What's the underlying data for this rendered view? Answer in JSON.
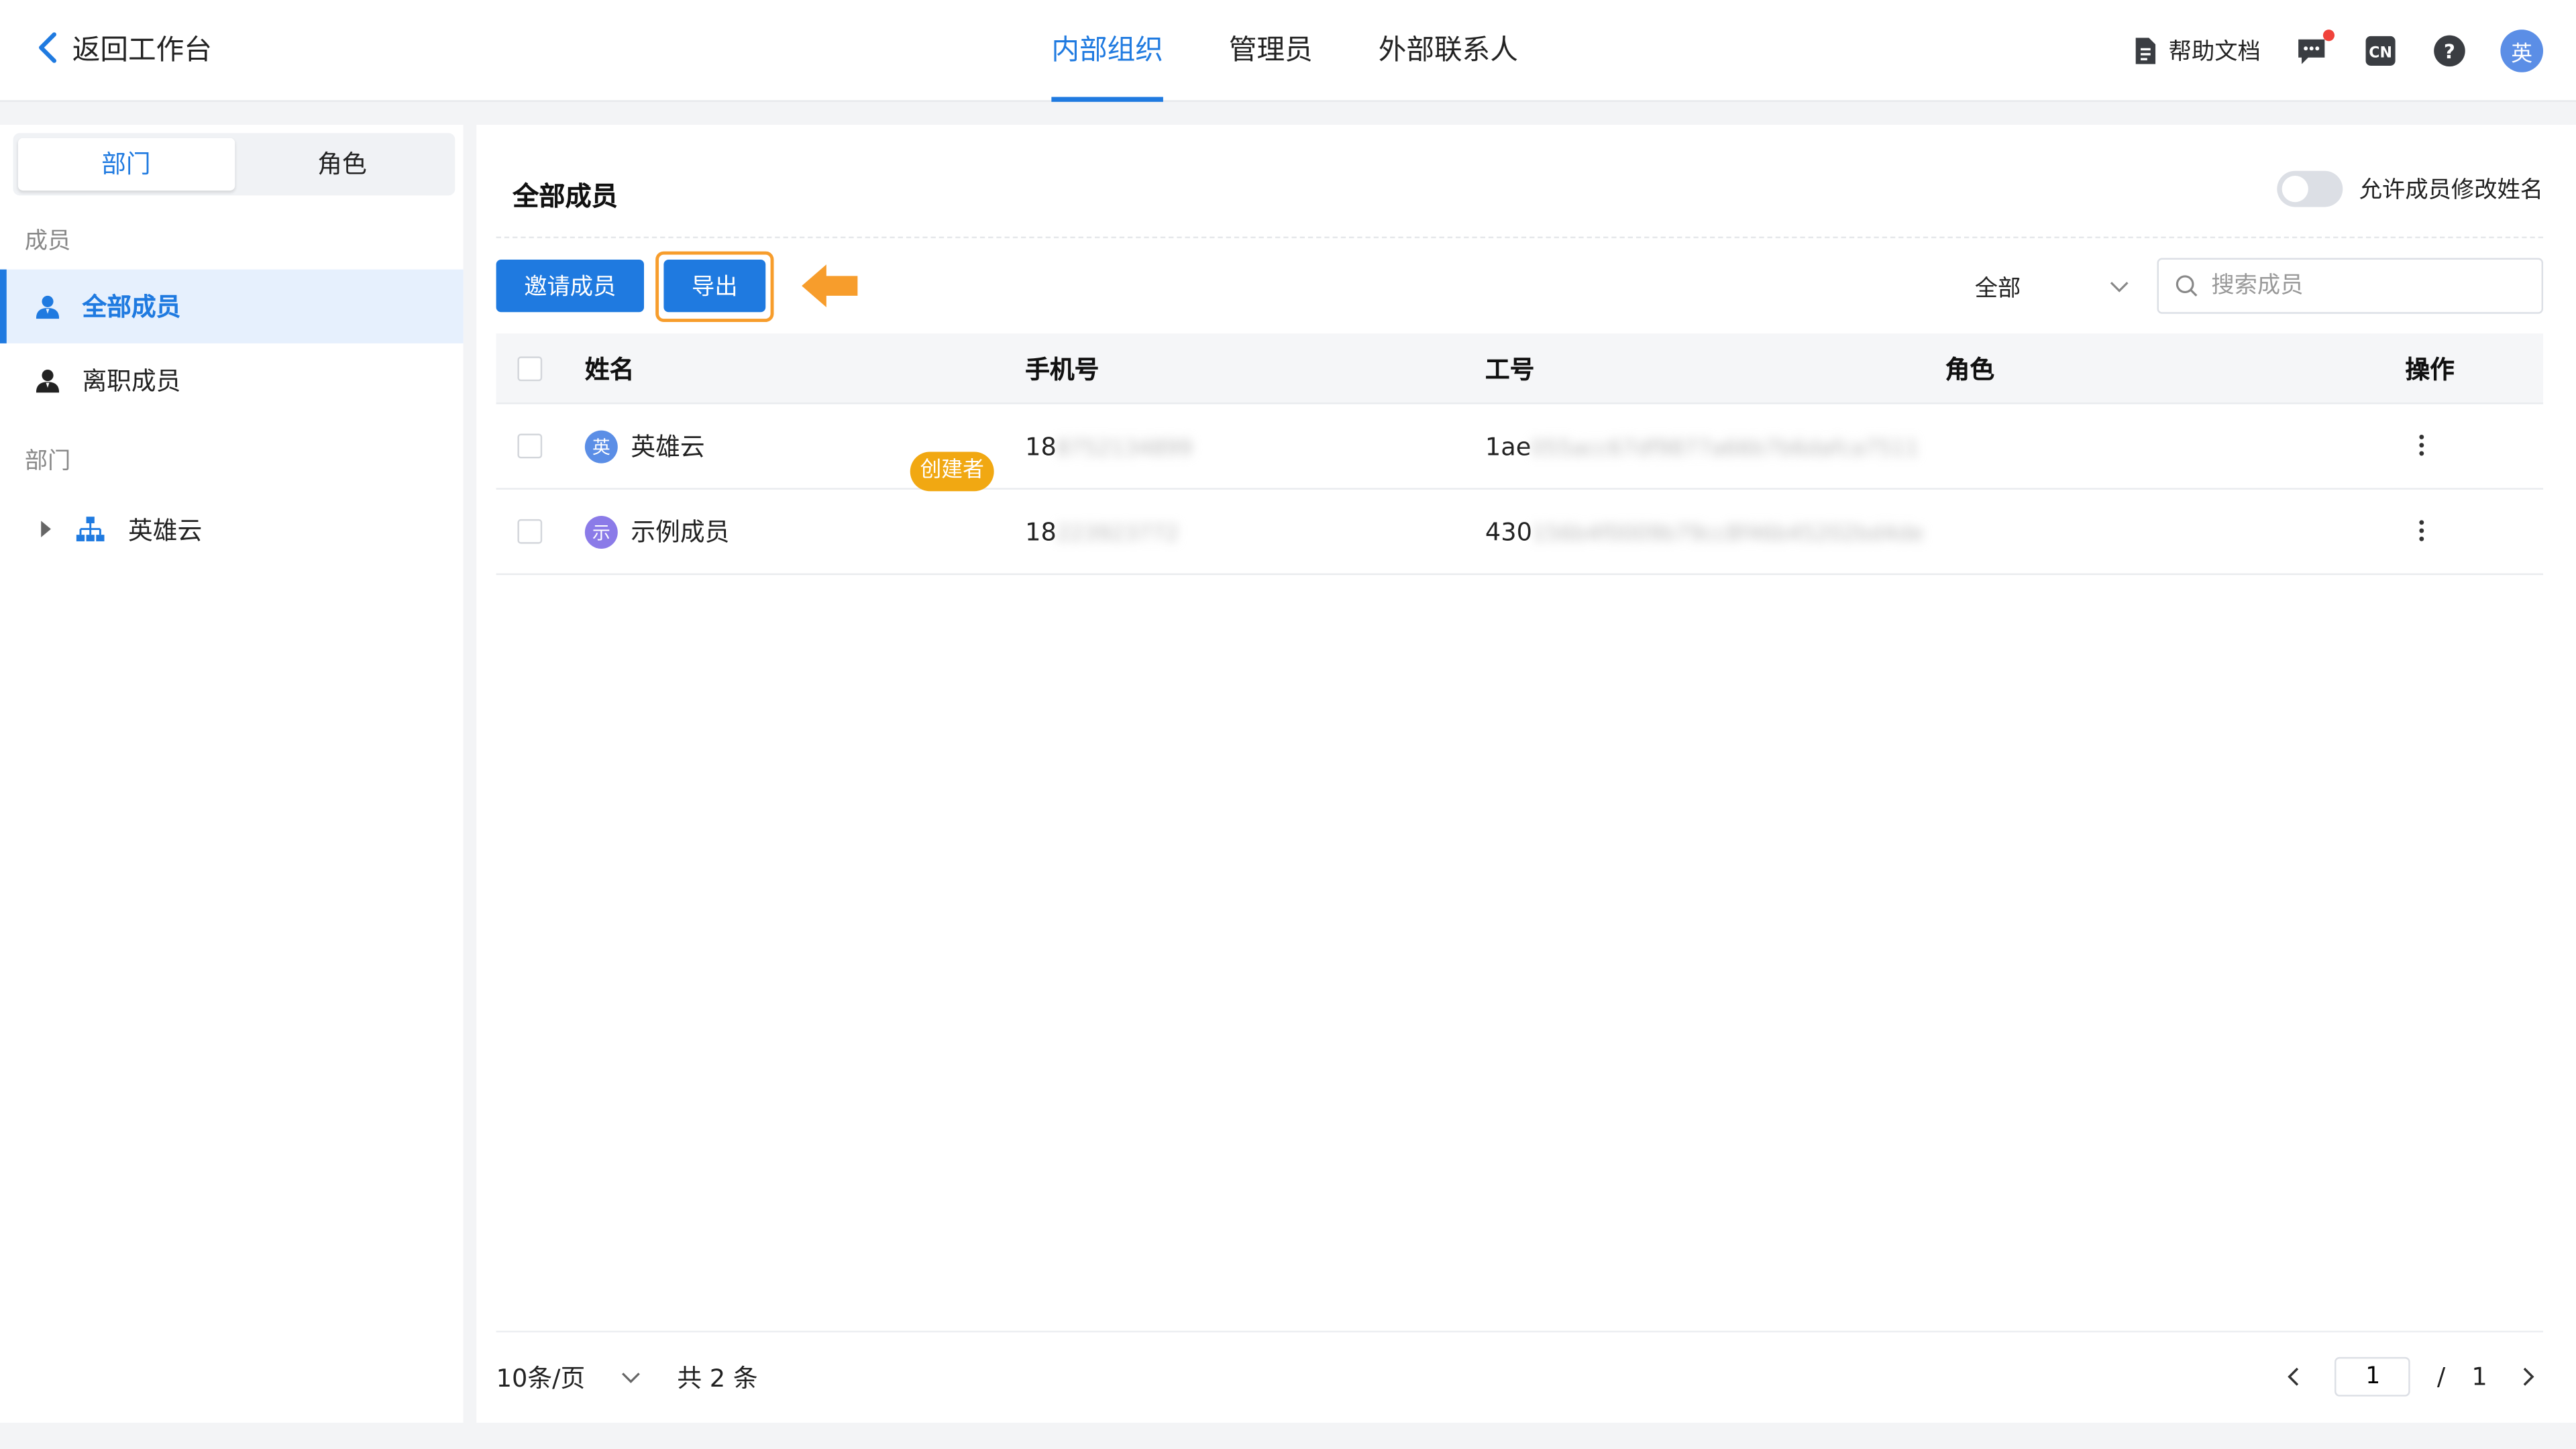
{
  "header": {
    "back_label": "返回工作台",
    "tabs": [
      {
        "label": "内部组织",
        "active": true
      },
      {
        "label": "管理员",
        "active": false
      },
      {
        "label": "外部联系人",
        "active": false
      }
    ],
    "help_label": "帮助文档",
    "lang_label": "CN",
    "help_icon_label": "?",
    "user_avatar_text": "英"
  },
  "sidebar": {
    "segments": [
      {
        "label": "部门",
        "active": true
      },
      {
        "label": "角色",
        "active": false
      }
    ],
    "members_section": "成员",
    "member_items": [
      {
        "label": "全部成员",
        "active": true
      },
      {
        "label": "离职成员",
        "active": false
      }
    ],
    "dept_section": "部门",
    "dept_root": "英雄云"
  },
  "main": {
    "title": "全部成员",
    "toggle_label": "允许成员修改姓名",
    "toggle_on": false,
    "invite_button": "邀请成员",
    "export_button": "导出",
    "highlight_color": "#f79d2c",
    "filter_value": "全部",
    "search_placeholder": "搜索成员",
    "table": {
      "headers": {
        "name": "姓名",
        "phone": "手机号",
        "id": "工号",
        "role": "角色",
        "op": "操作"
      },
      "rows": [
        {
          "avatar": "英",
          "avatar_color": "#5b8ee6",
          "name": "英雄云",
          "badge": "创建者",
          "phone_visible": "18",
          "phone_blurred": "8752134899",
          "id_visible": "1ae",
          "id_blurred": "055acc67df9877a66b7b6dafca7511",
          "role": ""
        },
        {
          "avatar": "示",
          "avatar_color": "#8b7be8",
          "name": "示例成员",
          "badge": "",
          "phone_visible": "18",
          "phone_blurred": "223923772",
          "id_visible": "430",
          "id_blurred": "156b4f0009b79cc8f46b45202bd4de",
          "role": ""
        }
      ]
    },
    "pagination": {
      "page_size": "10条/页",
      "total": "共 2 条",
      "current_page": "1",
      "separator": "/",
      "total_pages": "1"
    }
  },
  "colors": {
    "accent": "#1f7ae0",
    "badge": "#f1a812"
  }
}
